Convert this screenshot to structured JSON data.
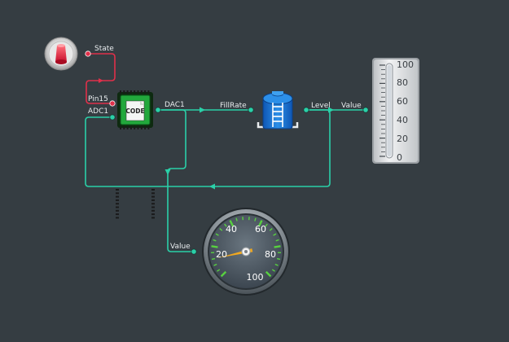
{
  "colors": {
    "background": "#353d42",
    "wire_data": "#2ad0a8",
    "wire_digital": "#e0304a",
    "port_data": "#2ad0a8",
    "port_digital": "#e0304a",
    "gauge_tick_green": "#58d040",
    "gauge_needle": "#f0a820"
  },
  "nodes": {
    "toggle_switch": {
      "icon": "toggle-switch-icon",
      "ports": {
        "state": "State"
      }
    },
    "microcontroller": {
      "icon": "microcontroller-chip-icon",
      "chip_label": "CODE",
      "ports": {
        "pin15": "Pin15",
        "adc1": "ADC1",
        "dac1": "DAC1"
      }
    },
    "water_tank": {
      "icon": "water-tank-icon",
      "ports": {
        "fill_rate": "FillRate",
        "level": "Level"
      }
    },
    "linear_gauge": {
      "icon": "vertical-gauge-icon",
      "port": "Value",
      "scale": [
        "100",
        "80",
        "60",
        "40",
        "20",
        "0"
      ],
      "level_percent": 100
    },
    "dial_gauge": {
      "icon": "dial-gauge-icon",
      "port": "Value",
      "scale": [
        "20",
        "40",
        "60",
        "80",
        "100"
      ],
      "needle_value": 12
    }
  }
}
